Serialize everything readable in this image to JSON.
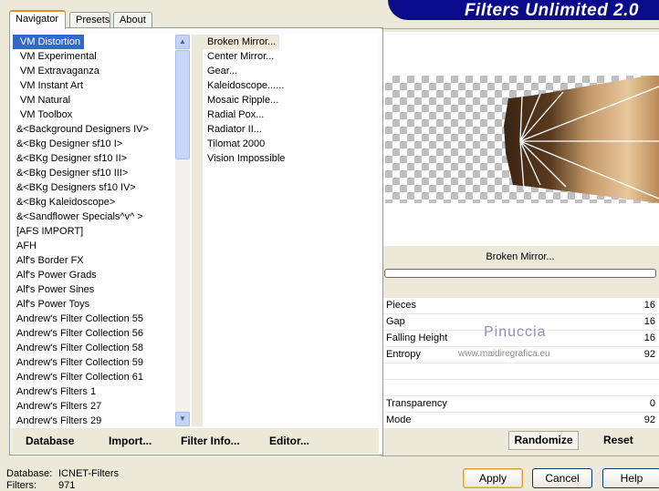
{
  "tabs": [
    "Navigator",
    "Presets",
    "About"
  ],
  "categories": [
    "VM Distortion",
    "VM Experimental",
    "VM Extravaganza",
    "VM Instant Art",
    "VM Natural",
    "VM Toolbox",
    "&<Background Designers IV>",
    "&<Bkg Designer sf10 I>",
    "&<BKg Designer sf10 II>",
    "&<Bkg Designer sf10 III>",
    "&<BKg Designers sf10 IV>",
    "&<Bkg Kaleidoscope>",
    "&<Sandflower Specials^v^ >",
    "[AFS IMPORT]",
    "AFH",
    "Alf's Border FX",
    "Alf's Power Grads",
    "Alf's Power Sines",
    "Alf's Power Toys",
    "Andrew's Filter Collection 55",
    "Andrew's Filter Collection 56",
    "Andrew's Filter Collection 58",
    "Andrew's Filter Collection 59",
    "Andrew's Filter Collection 61",
    "Andrew's Filters 1",
    "Andrew's Filters 27",
    "Andrew's Filters 29"
  ],
  "filters": [
    "Broken Mirror...",
    "Center Mirror...",
    "Gear...",
    "Kaleidoscope......",
    "Mosaic Ripple...",
    "Radial Pox...",
    "Radiator II...",
    "Tilomat 2000",
    "Vision Impossible"
  ],
  "buttons": {
    "database": "Database",
    "import": "Import...",
    "filter_info": "Filter Info...",
    "editor": "Editor...",
    "randomize": "Randomize",
    "reset": "Reset",
    "apply": "Apply",
    "cancel": "Cancel",
    "help": "Help"
  },
  "banner": "Filters Unlimited 2.0",
  "current_filter": "Broken Mirror...",
  "progress": 0,
  "params": [
    {
      "label": "Pieces",
      "value": "16"
    },
    {
      "label": "Gap",
      "value": "16"
    },
    {
      "label": "Falling Height",
      "value": "16"
    },
    {
      "label": "Entropy",
      "value": "92"
    },
    {
      "label": "",
      "value": ""
    },
    {
      "label": "",
      "value": ""
    },
    {
      "label": "Transparency",
      "value": "0"
    },
    {
      "label": "Mode",
      "value": "92"
    }
  ],
  "watermark": {
    "name": "Pinuccia",
    "url": "www.maidiregrafica.eu"
  },
  "status": {
    "database_label": "Database:",
    "database_value": "ICNET-Filters",
    "filters_label": "Filters:",
    "filters_value": "971"
  }
}
